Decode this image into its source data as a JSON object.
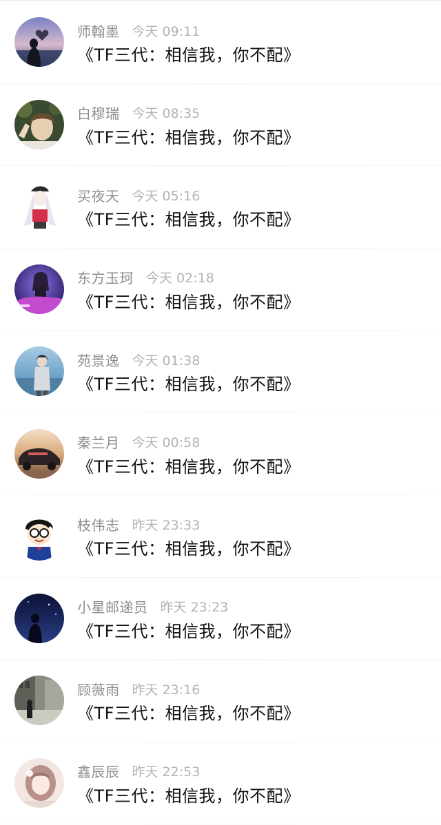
{
  "comments": [
    {
      "user": "师翰墨",
      "time": "今天 09:11",
      "text": "《TF三代：相信我，你不配》",
      "avatar_icon": "avatar-sunset-heart-icon",
      "avatar_colors": [
        "#5d6aa6",
        "#c9b4c8"
      ]
    },
    {
      "user": "白穆瑞",
      "time": "今天 08:35",
      "text": "《TF三代：相信我，你不配》",
      "avatar_icon": "avatar-boy-selfie-icon",
      "avatar_colors": [
        "#2e3b2a",
        "#d9c4a2"
      ]
    },
    {
      "user": "买夜天",
      "time": "今天 05:16",
      "text": "《TF三代：相信我，你不配》",
      "avatar_icon": "avatar-anime-girl-icon",
      "avatar_colors": [
        "#ffffff",
        "#d4304a"
      ]
    },
    {
      "user": "东方玉珂",
      "time": "今天 02:18",
      "text": "《TF三代：相信我，你不配》",
      "avatar_icon": "avatar-neon-car-icon",
      "avatar_colors": [
        "#3a2a9a",
        "#d04bd4"
      ]
    },
    {
      "user": "苑景逸",
      "time": "今天 01:38",
      "text": "《TF三代：相信我，你不配》",
      "avatar_icon": "avatar-seaside-person-icon",
      "avatar_colors": [
        "#7fb4d8",
        "#cfe0ea"
      ]
    },
    {
      "user": "秦兰月",
      "time": "今天 00:58",
      "text": "《TF三代：相信我，你不配》",
      "avatar_icon": "avatar-vintage-car-icon",
      "avatar_colors": [
        "#e7c7a0",
        "#4a3a34"
      ]
    },
    {
      "user": "枝伟志",
      "time": "昨天 23:33",
      "text": "《TF三代：相信我，你不配》",
      "avatar_icon": "avatar-cartoon-boy-glasses-icon",
      "avatar_colors": [
        "#ffffff",
        "#1f3f9a"
      ]
    },
    {
      "user": "小星邮递员",
      "time": "昨天 23:23",
      "text": "《TF三代：相信我，你不配》",
      "avatar_icon": "avatar-night-silhouette-icon",
      "avatar_colors": [
        "#0e1840",
        "#2c3a7a"
      ]
    },
    {
      "user": "顾薇雨",
      "time": "昨天 23:16",
      "text": "《TF三代：相信我，你不配》",
      "avatar_icon": "avatar-monochrome-street-icon",
      "avatar_colors": [
        "#6e7066",
        "#c9ccbf"
      ]
    },
    {
      "user": "鑫辰辰",
      "time": "昨天 22:53",
      "text": "《TF三代：相信我，你不配》",
      "avatar_icon": "avatar-soft-girl-icon",
      "avatar_colors": [
        "#f1e3e0",
        "#b9908a"
      ]
    }
  ]
}
